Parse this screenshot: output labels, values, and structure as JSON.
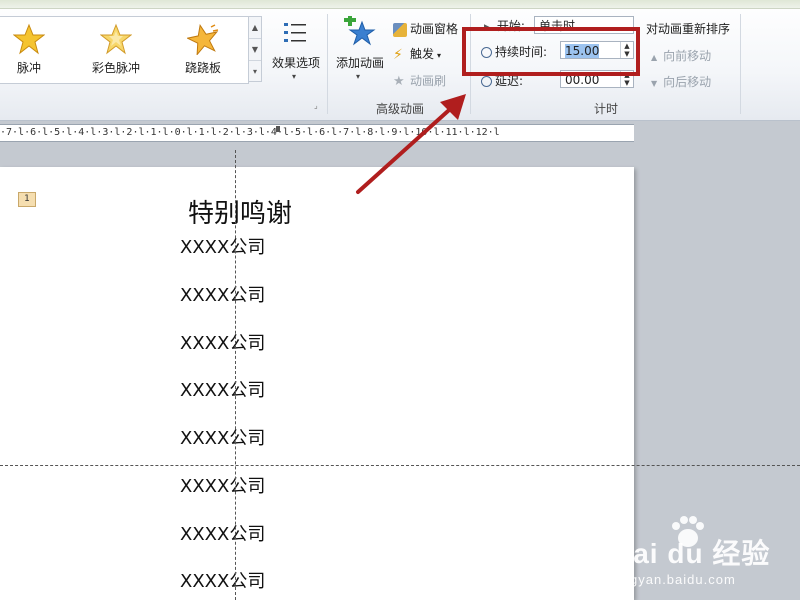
{
  "ribbon": {
    "gallery": {
      "items": [
        {
          "label": "脉冲",
          "icon": "star-pulse-icon"
        },
        {
          "label": "彩色脉冲",
          "icon": "star-color-pulse-icon"
        },
        {
          "label": "跷跷板",
          "icon": "star-teeter-icon"
        }
      ]
    },
    "effect_options": {
      "label": "效果选项",
      "icon": "effect-options-icon"
    },
    "advanced_animation": {
      "group_label": "高级动画",
      "add_animation": "添加动画",
      "animation_pane": "动画窗格",
      "trigger": "触发",
      "animation_painter": "动画刷"
    },
    "timing": {
      "group_label": "计时",
      "start_label": "开始:",
      "start_value": "单击时",
      "duration_label": "持续时间:",
      "duration_value": "15.00",
      "delay_label": "延迟:",
      "delay_value": "00.00",
      "reorder_title": "对动画重新排序",
      "move_earlier": "向前移动",
      "move_later": "向后移动"
    }
  },
  "ruler": {
    "text": "·7·l·6·l·5·l·4·l·3·l·2·l·1·l·0·l·1·l·2·l·3·l·4·l·5·l·6·l·7·l·8·l·9·l·10·l·11·l·12·l"
  },
  "slide": {
    "number": "1",
    "title": "特别鸣谢",
    "companies": [
      "XXXX公司",
      "XXXX公司",
      "XXXX公司",
      "XXXX公司",
      "XXXX公司",
      "XXXX公司",
      "XXXX公司",
      "XXXX公司"
    ]
  },
  "watermark": {
    "logo": "Bai du 经验",
    "url": "jingyan.baidu.com"
  },
  "colors": {
    "highlight_box": "#b01e1e",
    "arrow": "#b01e1e",
    "star_fill": "#f5c431",
    "selection": "#9cc3ef"
  }
}
